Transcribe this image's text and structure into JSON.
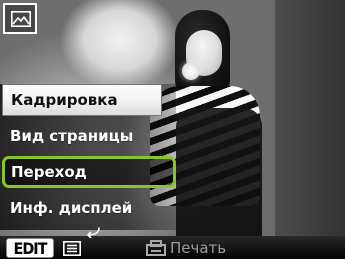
{
  "top_icon": {
    "name": "image-icon"
  },
  "menu": {
    "items": [
      {
        "label": "Кадрировка",
        "state": "highlighted"
      },
      {
        "label": "Вид страницы",
        "state": "normal"
      },
      {
        "label": "Переход",
        "state": "selected"
      },
      {
        "label": "Инф. дисплей",
        "state": "normal"
      }
    ],
    "selection_color": "#88c52a"
  },
  "bottom": {
    "edit_label": "EDIT",
    "print_label": "Печать",
    "icons": [
      "list-icon",
      "return-arrow-icon",
      "print-icon"
    ],
    "print_text_color": "#9b9b9b"
  }
}
